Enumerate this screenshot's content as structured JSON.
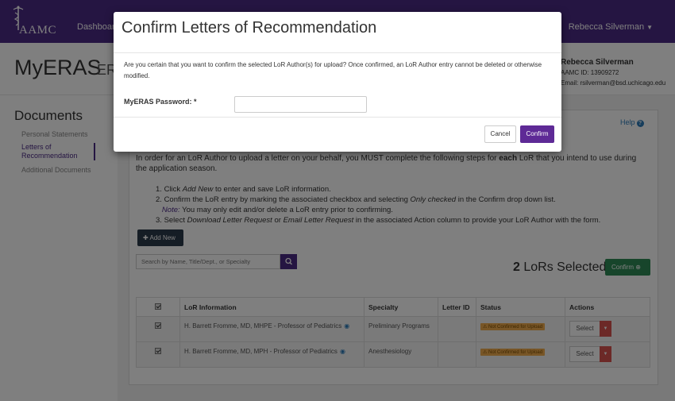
{
  "nav": {
    "logo_text": "AAMC",
    "dashboard": "Dashboard",
    "user_menu": "Rebecca Silverman"
  },
  "header": {
    "title": "MyERAS",
    "subtitle_partial": "ER",
    "user_name": "Rebecca Silverman",
    "aamc_id": "AAMC ID: 13909272",
    "email": "Email: rsilverman@bsd.uchicago.edu"
  },
  "sidebar": {
    "title": "Documents",
    "items": [
      {
        "label": "Personal Statements"
      },
      {
        "label": "Letters of Recommendation"
      },
      {
        "label": "Additional Documents"
      }
    ]
  },
  "main": {
    "help": "Help",
    "intro_pre": "In order for an LoR Author to upload a letter on your behalf, you MUST complete the following steps for ",
    "intro_bold": "each",
    "intro_post": " LoR that you intend to use during the application season.",
    "steps": {
      "s1a": "Click ",
      "s1b": "Add New",
      "s1c": " to enter and save LoR information.",
      "s2a": "Confirm the LoR entry by marking the associated checkbox and selecting ",
      "s2b": "Only checked",
      "s2c": " in the Confirm drop down list.",
      "note_label": "Note:",
      "note_text": " You may only edit and/or delete a LoR entry prior to confirming.",
      "s3a": "Select ",
      "s3b": "Download Letter Request",
      "s3c": " or ",
      "s3d": "Email Letter Request",
      "s3e": " in the associated Action column to provide your LoR Author with the form."
    },
    "add_new": "Add New",
    "search_placeholder": "Search by Name, Title/Dept., or Specialty",
    "lors_selected_count": "2",
    "lors_selected_label": "LoRs Selected",
    "confirm_button": "Confirm"
  },
  "table": {
    "headers": [
      "LoR Information",
      "Specialty",
      "Letter ID",
      "Status",
      "Actions"
    ],
    "rows": [
      {
        "info": "H. Barrett Fromme, MD, MHPE - Professor of Pediatrics",
        "specialty": "Preliminary Programs",
        "letter_id": "",
        "status": "Not Confirmed for Upload",
        "action": "Select"
      },
      {
        "info": "H. Barrett Fromme, MD, MPH - Professor of Pediatrics",
        "specialty": "Anesthesiology",
        "letter_id": "",
        "status": "Not Confirmed for Upload",
        "action": "Select"
      }
    ]
  },
  "modal": {
    "title": "Confirm Letters of Recommendation",
    "message": "Are you certain that you want to confirm the selected LoR Author(s) for upload? Once confirmed, an LoR Author entry cannot be deleted or otherwise modified.",
    "password_label": "MyERAS Password: *",
    "password_value": "",
    "cancel": "Cancel",
    "confirm": "Confirm"
  }
}
